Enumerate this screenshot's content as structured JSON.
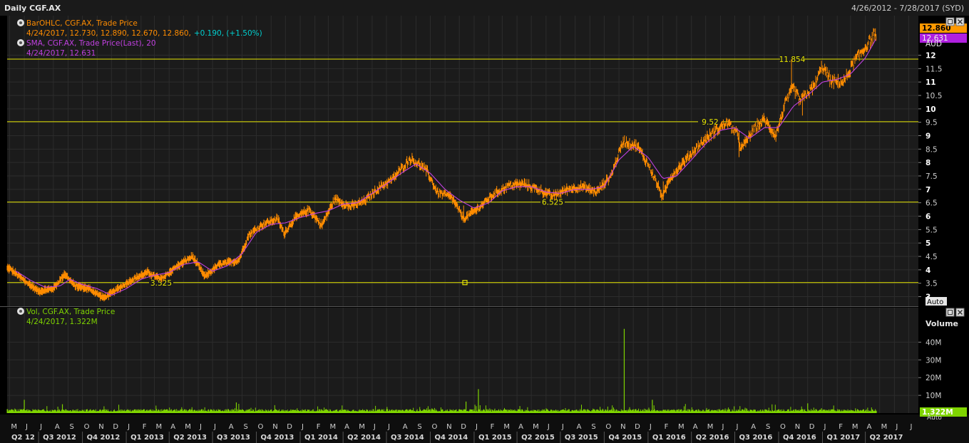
{
  "header": {
    "title": "Daily CGF.AX",
    "date_range": "4/26/2012 - 7/28/2017 (SYD)"
  },
  "price_legend": {
    "line1": "BarOHLC, CGF.AX, Trade Price",
    "line2_prefix": "4/24/2017, 12.730, 12.890, 12.670, 12.860,",
    "line2_change": "+0.190, (+1.50%)",
    "sma_line1": "SMA, CGF.AX, Trade Price(Last),  20",
    "sma_line2": "4/24/2017, 12.631"
  },
  "volume_legend": {
    "line1": "Vol, CGF.AX, Trade Price",
    "line2": "4/24/2017, 1.322M"
  },
  "price_axis": {
    "ticks": [
      "12",
      "11.5",
      "11",
      "10.5",
      "10",
      "9.5",
      "9",
      "8.5",
      "8",
      "7.5",
      "7",
      "6.5",
      "6",
      "5.5",
      "5",
      "4.5",
      "4",
      "3.5",
      "3"
    ],
    "currency": "AUD",
    "last_price": "12.860",
    "last_sma": "12.631",
    "auto_label": "Auto"
  },
  "volume_axis": {
    "title": "Volume",
    "ticks": [
      "40M",
      "30M",
      "20M",
      "10M"
    ],
    "last_volume": "1.322M",
    "auto_label": "Auto"
  },
  "horizontal_lines": [
    {
      "level": 11.854,
      "label": "11.854"
    },
    {
      "level": 9.52,
      "label": "9.52"
    },
    {
      "level": 6.525,
      "label": "6.525"
    },
    {
      "level": 3.525,
      "label": "3.525"
    }
  ],
  "month_labels": [
    "M",
    "J",
    "J",
    "A",
    "S",
    "O",
    "N",
    "D",
    "J",
    "F",
    "M",
    "A",
    "M",
    "J",
    "J",
    "A",
    "S",
    "O",
    "N",
    "D",
    "J",
    "F",
    "M",
    "A",
    "M",
    "J",
    "J",
    "A",
    "S",
    "O",
    "N",
    "D",
    "J",
    "F",
    "M",
    "A",
    "M",
    "J",
    "J",
    "A",
    "S",
    "O",
    "N",
    "D",
    "J",
    "F",
    "M",
    "A",
    "M",
    "J",
    "J",
    "A",
    "S",
    "O",
    "N",
    "D",
    "J",
    "F",
    "M",
    "A",
    "M",
    "J",
    "J"
  ],
  "quarter_labels": [
    "Q2 12",
    "Q3 2012",
    "Q4 2012",
    "Q1 2013",
    "Q2 2013",
    "Q3 2013",
    "Q4 2013",
    "Q1 2014",
    "Q2 2014",
    "Q3 2014",
    "Q4 2014",
    "Q1 2015",
    "Q2 2015",
    "Q3 2015",
    "Q4 2015",
    "Q1 2016",
    "Q2 2016",
    "Q3 2016",
    "Q4 2016",
    "Q1 2017",
    "Q2 2017"
  ],
  "colors": {
    "price": "#ff8c00",
    "sma": "#c040e0",
    "hline": "#e6e600",
    "volume": "#7fd400",
    "change": "#00d0d0",
    "grid": "#2c2c2c"
  },
  "chart_data": [
    {
      "type": "line",
      "title": "Daily CGF.AX",
      "x_range": [
        "2012-04-26",
        "2017-07-28"
      ],
      "ylim": [
        2.8,
        13.2
      ],
      "y_unit": "AUD",
      "grid": true,
      "series": [
        {
          "name": "BarOHLC, CGF.AX, Trade Price",
          "points": [
            [
              "2012-05-01",
              4.05
            ],
            [
              "2012-06-01",
              3.6
            ],
            [
              "2012-07-01",
              3.2
            ],
            [
              "2012-08-01",
              3.3
            ],
            [
              "2012-08-25",
              3.85
            ],
            [
              "2012-09-15",
              3.4
            ],
            [
              "2012-10-15",
              3.3
            ],
            [
              "2012-11-15",
              2.95
            ],
            [
              "2012-12-15",
              3.3
            ],
            [
              "2013-01-15",
              3.65
            ],
            [
              "2013-02-15",
              3.9
            ],
            [
              "2013-03-15",
              3.65
            ],
            [
              "2013-04-15",
              4.1
            ],
            [
              "2013-05-20",
              4.5
            ],
            [
              "2013-06-15",
              3.75
            ],
            [
              "2013-07-15",
              4.2
            ],
            [
              "2013-08-25",
              4.35
            ],
            [
              "2013-09-15",
              5.3
            ],
            [
              "2013-10-15",
              5.7
            ],
            [
              "2013-11-15",
              5.9
            ],
            [
              "2013-11-28",
              5.35
            ],
            [
              "2013-12-20",
              5.9
            ],
            [
              "2014-01-20",
              6.25
            ],
            [
              "2014-02-15",
              5.65
            ],
            [
              "2014-03-15",
              6.65
            ],
            [
              "2014-04-15",
              6.35
            ],
            [
              "2014-05-15",
              6.55
            ],
            [
              "2014-06-15",
              7.05
            ],
            [
              "2014-07-15",
              7.4
            ],
            [
              "2014-08-20",
              8.15
            ],
            [
              "2014-09-10",
              7.9
            ],
            [
              "2014-09-25",
              7.65
            ],
            [
              "2014-10-15",
              6.9
            ],
            [
              "2014-11-15",
              6.7
            ],
            [
              "2014-12-10",
              5.9
            ],
            [
              "2015-01-10",
              6.3
            ],
            [
              "2015-02-10",
              6.8
            ],
            [
              "2015-03-15",
              7.15
            ],
            [
              "2015-04-15",
              7.2
            ],
            [
              "2015-05-15",
              7.0
            ],
            [
              "2015-06-15",
              6.75
            ],
            [
              "2015-07-15",
              7.0
            ],
            [
              "2015-08-15",
              7.1
            ],
            [
              "2015-09-15",
              6.9
            ],
            [
              "2015-10-15",
              7.5
            ],
            [
              "2015-11-10",
              8.8
            ],
            [
              "2015-12-10",
              8.6
            ],
            [
              "2016-01-05",
              7.8
            ],
            [
              "2016-01-20",
              7.2
            ],
            [
              "2016-02-01",
              6.7
            ],
            [
              "2016-02-15",
              7.4
            ],
            [
              "2016-03-15",
              8.0
            ],
            [
              "2016-04-15",
              8.6
            ],
            [
              "2016-05-15",
              9.1
            ],
            [
              "2016-06-15",
              9.5
            ],
            [
              "2016-07-05",
              9.1
            ],
            [
              "2016-07-15",
              8.5
            ],
            [
              "2016-08-10",
              9.25
            ],
            [
              "2016-09-01",
              9.6
            ],
            [
              "2016-09-25",
              9.0
            ],
            [
              "2016-10-15",
              10.2
            ],
            [
              "2016-11-01",
              10.8
            ],
            [
              "2016-11-15",
              10.3
            ],
            [
              "2016-12-15",
              10.85
            ],
            [
              "2017-01-01",
              11.6
            ],
            [
              "2017-01-20",
              11.0
            ],
            [
              "2017-02-15",
              11.0
            ],
            [
              "2017-03-10",
              11.8
            ],
            [
              "2017-04-01",
              12.3
            ],
            [
              "2017-04-24",
              12.86
            ]
          ]
        },
        {
          "name": "SMA, CGF.AX, Trade Price(Last), 20",
          "points": [
            [
              "2012-05-15",
              3.95
            ],
            [
              "2012-06-15",
              3.6
            ],
            [
              "2012-07-15",
              3.35
            ],
            [
              "2012-08-15",
              3.4
            ],
            [
              "2012-09-05",
              3.65
            ],
            [
              "2012-10-01",
              3.45
            ],
            [
              "2012-11-01",
              3.3
            ],
            [
              "2012-12-01",
              3.05
            ],
            [
              "2013-01-01",
              3.3
            ],
            [
              "2013-02-01",
              3.65
            ],
            [
              "2013-03-01",
              3.8
            ],
            [
              "2013-04-01",
              3.9
            ],
            [
              "2013-05-01",
              4.2
            ],
            [
              "2013-06-01",
              4.3
            ],
            [
              "2013-07-01",
              3.95
            ],
            [
              "2013-08-01",
              4.15
            ],
            [
              "2013-09-01",
              4.6
            ],
            [
              "2013-10-01",
              5.4
            ],
            [
              "2013-11-01",
              5.7
            ],
            [
              "2013-12-01",
              5.75
            ],
            [
              "2014-01-01",
              5.95
            ],
            [
              "2014-02-01",
              6.1
            ],
            [
              "2014-03-01",
              6.2
            ],
            [
              "2014-04-01",
              6.45
            ],
            [
              "2014-05-01",
              6.5
            ],
            [
              "2014-06-01",
              6.85
            ],
            [
              "2014-07-01",
              7.2
            ],
            [
              "2014-08-01",
              7.6
            ],
            [
              "2014-09-01",
              7.95
            ],
            [
              "2014-10-01",
              7.6
            ],
            [
              "2014-11-01",
              7.0
            ],
            [
              "2014-12-01",
              6.6
            ],
            [
              "2015-01-01",
              6.3
            ],
            [
              "2015-02-01",
              6.5
            ],
            [
              "2015-03-01",
              6.95
            ],
            [
              "2015-04-01",
              7.1
            ],
            [
              "2015-05-01",
              7.1
            ],
            [
              "2015-06-01",
              6.9
            ],
            [
              "2015-07-01",
              6.85
            ],
            [
              "2015-08-01",
              7.0
            ],
            [
              "2015-09-01",
              7.0
            ],
            [
              "2015-10-01",
              7.1
            ],
            [
              "2015-11-01",
              8.1
            ],
            [
              "2015-12-01",
              8.6
            ],
            [
              "2016-01-01",
              8.2
            ],
            [
              "2016-02-01",
              7.4
            ],
            [
              "2016-03-01",
              7.5
            ],
            [
              "2016-04-01",
              8.1
            ],
            [
              "2016-05-01",
              8.7
            ],
            [
              "2016-06-01",
              9.2
            ],
            [
              "2016-07-01",
              9.3
            ],
            [
              "2016-08-01",
              8.9
            ],
            [
              "2016-09-01",
              9.3
            ],
            [
              "2016-10-01",
              9.3
            ],
            [
              "2016-11-01",
              10.1
            ],
            [
              "2016-12-01",
              10.5
            ],
            [
              "2017-01-01",
              11.0
            ],
            [
              "2017-02-01",
              11.1
            ],
            [
              "2017-03-01",
              11.3
            ],
            [
              "2017-04-01",
              11.9
            ],
            [
              "2017-04-24",
              12.631
            ]
          ]
        }
      ]
    },
    {
      "type": "bar",
      "title": "Vol, CGF.AX, Trade Price",
      "ylim": [
        0,
        50
      ],
      "y_unit": "M",
      "series": [
        {
          "name": "Vol, CGF.AX, Trade Price",
          "baseline": 1.5,
          "spikes": [
            [
              "2012-06-01",
              7.5
            ],
            [
              "2012-08-20",
              5.0
            ],
            [
              "2013-08-20",
              6.0
            ],
            [
              "2014-12-15",
              6.5
            ],
            [
              "2015-01-10",
              13.5
            ],
            [
              "2015-11-12",
              47.5
            ],
            [
              "2016-01-10",
              7.5
            ],
            [
              "2016-12-01",
              5.5
            ],
            [
              "2017-04-24",
              1.322
            ]
          ]
        }
      ]
    }
  ]
}
